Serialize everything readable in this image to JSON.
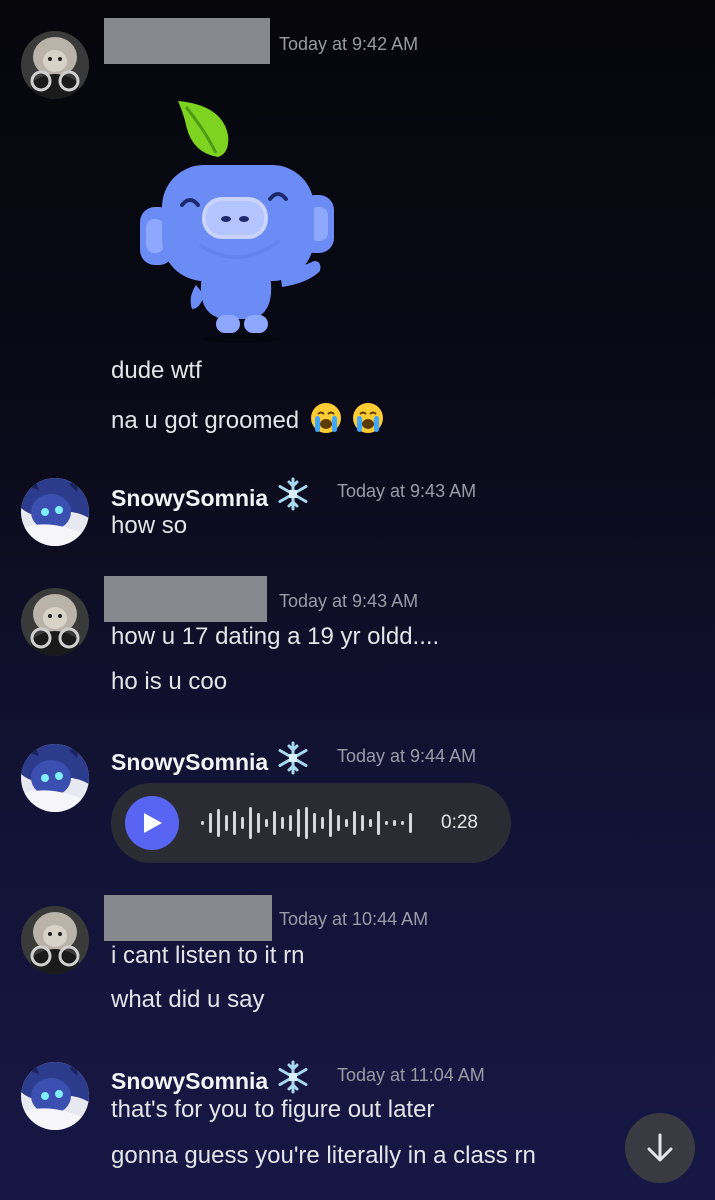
{
  "messages": [
    {
      "author": "",
      "redacted": true,
      "timestamp": "Today at 9:42 AM",
      "lines": [
        "dude wtf",
        "na u got groomed"
      ],
      "sticker": "wumpus-leaf-sticker",
      "emoji": [
        "loudly-crying-face",
        "loudly-crying-face"
      ]
    },
    {
      "author": "SnowySomnia",
      "badge": "snowflake-icon",
      "timestamp": "Today at 9:43 AM",
      "lines": [
        "how so"
      ]
    },
    {
      "author": "",
      "redacted": true,
      "timestamp": "Today at 9:43 AM",
      "lines": [
        "how u 17 dating a 19 yr oldd....",
        "ho is u coo"
      ]
    },
    {
      "author": "SnowySomnia",
      "badge": "snowflake-icon",
      "timestamp": "Today at 9:44 AM",
      "voice_message": {
        "duration": "0:28"
      }
    },
    {
      "author": "",
      "redacted": true,
      "timestamp": "Today at 10:44 AM",
      "lines": [
        "i cant listen to it rn",
        "what did u say"
      ]
    },
    {
      "author": "SnowySomnia",
      "badge": "snowflake-icon",
      "timestamp": "Today at 11:04 AM",
      "lines": [
        "that's for you to figure out later",
        "gonna guess you're literally in a class rn"
      ]
    }
  ],
  "controls": {
    "jump_to_present_icon": "arrow-down-icon",
    "play_icon": "play-icon"
  },
  "colors": {
    "accent": "#5865f2",
    "sticker_leaf": "#7ed321",
    "sticker_body": "#6c8cf5",
    "snowflake": "#a8d8f0"
  }
}
